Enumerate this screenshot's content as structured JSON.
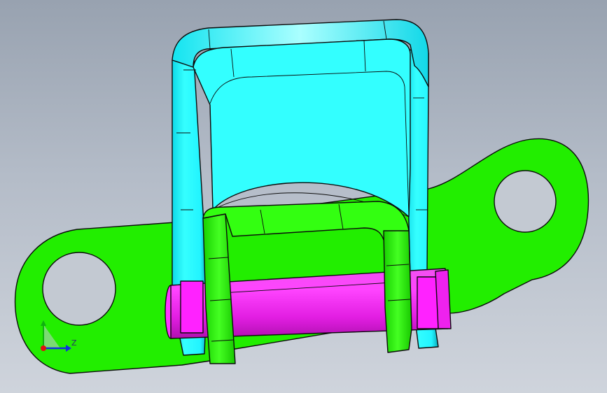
{
  "viewport": {
    "background_top": "#98a2b0",
    "background_bottom": "#cfd4dc"
  },
  "model": {
    "parts": [
      {
        "name": "bracket-base-plate",
        "color": "#22ee00"
      },
      {
        "name": "u-frame",
        "color": "#22ffff"
      },
      {
        "name": "inner-clevis",
        "color": "#33ff11"
      },
      {
        "name": "pivot-pin",
        "color": "#ff22ff"
      }
    ]
  },
  "triad": {
    "axis_label": "Z",
    "x_color": "#e01010",
    "y_color": "#10b010",
    "z_color": "#1030e0"
  }
}
